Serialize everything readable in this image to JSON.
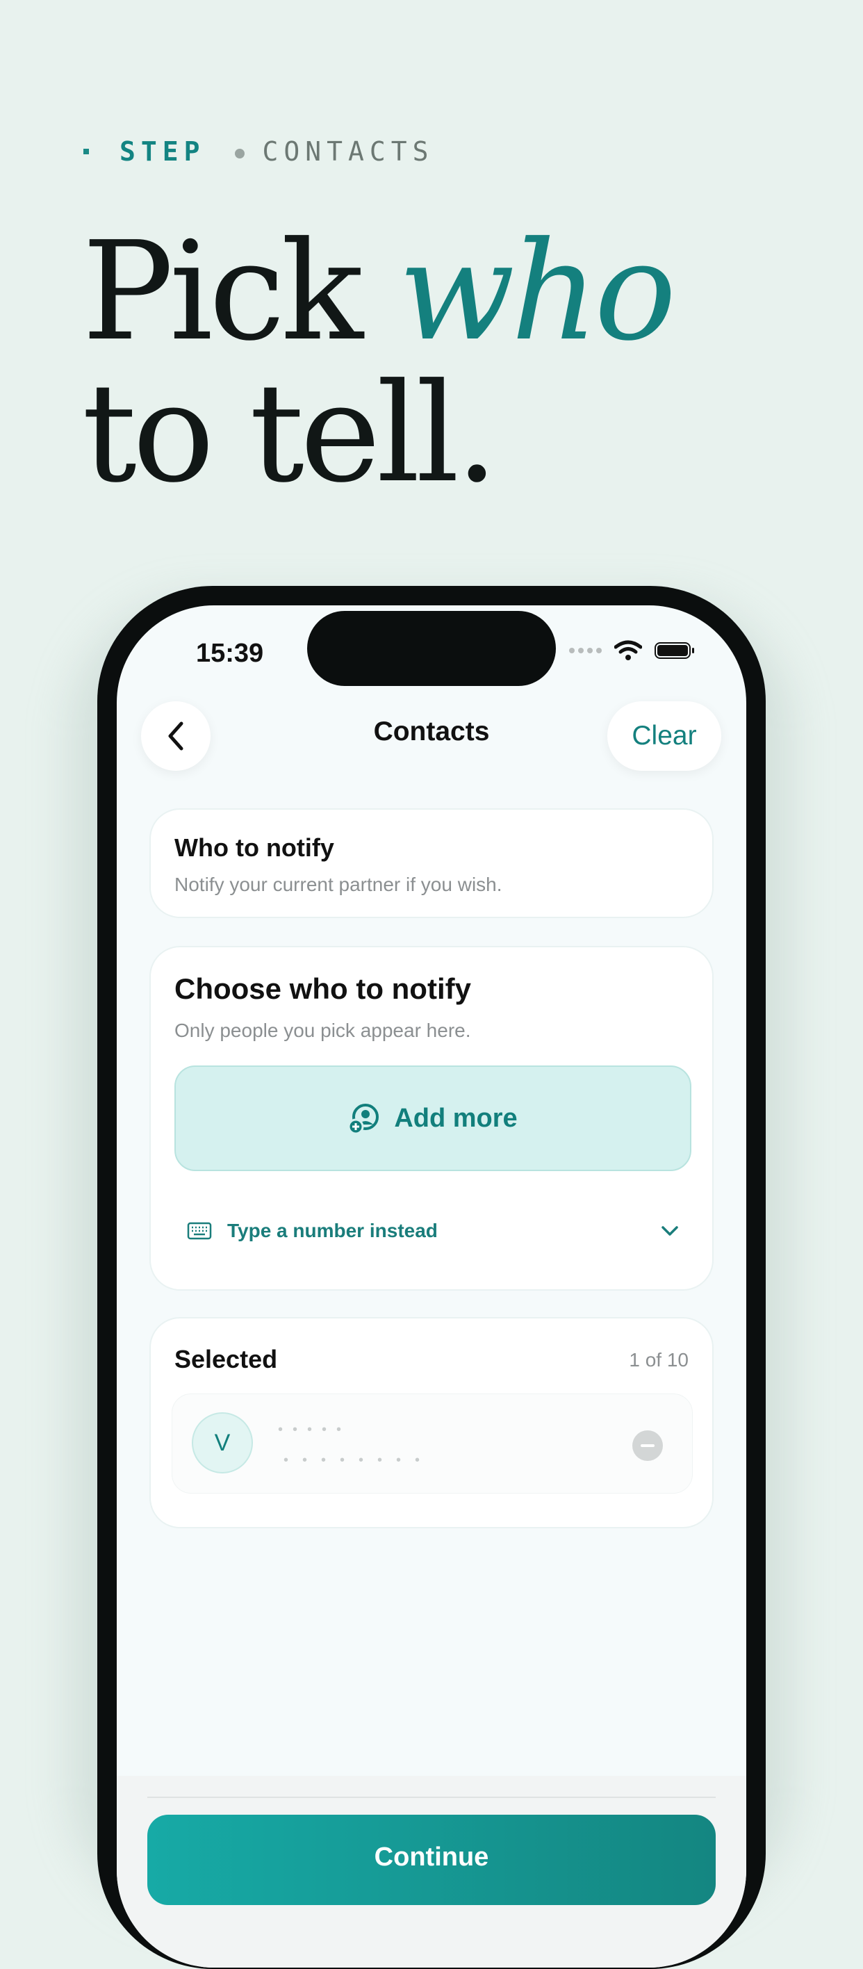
{
  "eyebrow": {
    "step_label": "STEP",
    "section_label": "CONTACTS"
  },
  "headline": {
    "part1": "Pick ",
    "accent": "who",
    "part2": "to tell."
  },
  "status_bar": {
    "time": "15:39"
  },
  "nav": {
    "title": "Contacts",
    "clear_label": "Clear",
    "back_icon": "chevron-left-icon"
  },
  "notify_card": {
    "title": "Who to notify",
    "subtitle": "Notify your current partner if you wish."
  },
  "choose_card": {
    "title": "Choose who to notify",
    "subtitle": "Only people you pick appear here.",
    "add_more_label": "Add more",
    "type_number_label": "Type a number instead"
  },
  "selected_card": {
    "title": "Selected",
    "count": "1 of 10",
    "contacts": [
      {
        "initial": "V",
        "name_masked": "•••••",
        "phone_masked": "••••••••"
      }
    ]
  },
  "footer": {
    "continue_label": "Continue"
  },
  "colors": {
    "accent": "#14807e",
    "background": "#e8f2ee",
    "button_gradient_start": "#17aaa6"
  }
}
